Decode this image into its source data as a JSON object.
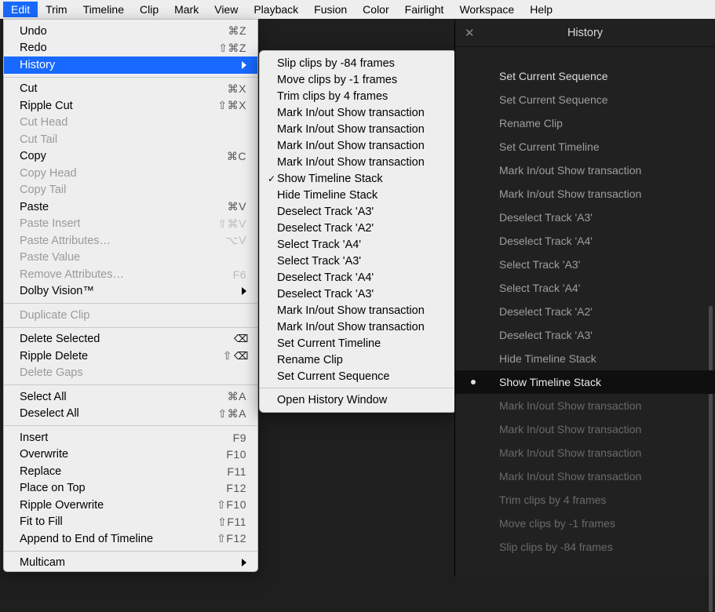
{
  "menubar": {
    "items": [
      "Edit",
      "Trim",
      "Timeline",
      "Clip",
      "Mark",
      "View",
      "Playback",
      "Fusion",
      "Color",
      "Fairlight",
      "Workspace",
      "Help"
    ],
    "active_index": 0
  },
  "edit_menu": {
    "groups": [
      [
        {
          "label": "Undo",
          "shortcut": "⌘Z",
          "disabled": false
        },
        {
          "label": "Redo",
          "shortcut": "⇧⌘Z",
          "disabled": false
        },
        {
          "label": "History",
          "submenu": true,
          "highlight": true
        }
      ],
      [
        {
          "label": "Cut",
          "shortcut": "⌘X",
          "disabled": false
        },
        {
          "label": "Ripple Cut",
          "shortcut": "⇧⌘X",
          "disabled": false
        },
        {
          "label": "Cut Head",
          "disabled": true
        },
        {
          "label": "Cut Tail",
          "disabled": true
        },
        {
          "label": "Copy",
          "shortcut": "⌘C",
          "disabled": false
        },
        {
          "label": "Copy Head",
          "disabled": true
        },
        {
          "label": "Copy Tail",
          "disabled": true
        },
        {
          "label": "Paste",
          "shortcut": "⌘V",
          "disabled": false
        },
        {
          "label": "Paste Insert",
          "shortcut": "⇧⌘V",
          "disabled": true
        },
        {
          "label": "Paste Attributes…",
          "shortcut": "⌥V",
          "disabled": true
        },
        {
          "label": "Paste Value",
          "disabled": true
        },
        {
          "label": "Remove Attributes…",
          "shortcut": "F6",
          "disabled": true
        },
        {
          "label": "Dolby Vision™",
          "submenu": true,
          "disabled": false
        }
      ],
      [
        {
          "label": "Duplicate Clip",
          "disabled": true
        }
      ],
      [
        {
          "label": "Delete Selected",
          "glyph": "⌫",
          "disabled": false
        },
        {
          "label": "Ripple Delete",
          "shortcut": "⇧",
          "glyph": "⌫",
          "disabled": false
        },
        {
          "label": "Delete Gaps",
          "disabled": true
        }
      ],
      [
        {
          "label": "Select All",
          "shortcut": "⌘A",
          "disabled": false
        },
        {
          "label": "Deselect All",
          "shortcut": "⇧⌘A",
          "disabled": false
        }
      ],
      [
        {
          "label": "Insert",
          "shortcut": "F9",
          "disabled": false
        },
        {
          "label": "Overwrite",
          "shortcut": "F10",
          "disabled": false
        },
        {
          "label": "Replace",
          "shortcut": "F11",
          "disabled": false
        },
        {
          "label": "Place on Top",
          "shortcut": "F12",
          "disabled": false
        },
        {
          "label": "Ripple Overwrite",
          "shortcut": "⇧F10",
          "disabled": false
        },
        {
          "label": "Fit to Fill",
          "shortcut": "⇧F11",
          "disabled": false
        },
        {
          "label": "Append to End of Timeline",
          "shortcut": "⇧F12",
          "disabled": false
        }
      ],
      [
        {
          "label": "Multicam",
          "submenu": true,
          "disabled": false
        }
      ]
    ]
  },
  "history_submenu": {
    "items": [
      {
        "label": "Slip clips by -84 frames"
      },
      {
        "label": "Move clips by -1 frames"
      },
      {
        "label": "Trim clips by 4 frames"
      },
      {
        "label": "Mark In/out Show transaction"
      },
      {
        "label": "Mark In/out Show transaction"
      },
      {
        "label": "Mark In/out Show transaction"
      },
      {
        "label": "Mark In/out Show transaction"
      },
      {
        "label": "Show Timeline Stack",
        "checked": true
      },
      {
        "label": "Hide Timeline Stack"
      },
      {
        "label": "Deselect Track 'A3'"
      },
      {
        "label": "Deselect Track 'A2'"
      },
      {
        "label": "Select Track 'A4'"
      },
      {
        "label": "Select Track 'A3'"
      },
      {
        "label": "Deselect Track 'A4'"
      },
      {
        "label": "Deselect Track 'A3'"
      },
      {
        "label": "Mark In/out Show transaction"
      },
      {
        "label": "Mark In/out Show transaction"
      },
      {
        "label": "Set Current Timeline"
      },
      {
        "label": "Rename Clip"
      },
      {
        "label": "Set Current Sequence"
      }
    ],
    "footer": {
      "label": "Open History Window"
    }
  },
  "history_panel": {
    "title": "History",
    "items": [
      {
        "label": "Set Current Sequence",
        "tone": "bright"
      },
      {
        "label": "Set Current Sequence",
        "tone": "mid"
      },
      {
        "label": "Rename Clip",
        "tone": "mid"
      },
      {
        "label": "Set Current Timeline",
        "tone": "mid"
      },
      {
        "label": "Mark In/out Show transaction",
        "tone": "mid"
      },
      {
        "label": "Mark In/out Show transaction",
        "tone": "mid"
      },
      {
        "label": "Deselect Track 'A3'",
        "tone": "mid"
      },
      {
        "label": "Deselect Track 'A4'",
        "tone": "mid"
      },
      {
        "label": "Select Track 'A3'",
        "tone": "mid"
      },
      {
        "label": "Select Track 'A4'",
        "tone": "mid"
      },
      {
        "label": "Deselect Track 'A2'",
        "tone": "mid"
      },
      {
        "label": "Deselect Track 'A3'",
        "tone": "mid"
      },
      {
        "label": "Hide Timeline Stack",
        "tone": "mid"
      },
      {
        "label": "Show Timeline Stack",
        "tone": "bright",
        "current": true
      },
      {
        "label": "Mark In/out Show transaction",
        "tone": "dim"
      },
      {
        "label": "Mark In/out Show transaction",
        "tone": "dim"
      },
      {
        "label": "Mark In/out Show transaction",
        "tone": "dim"
      },
      {
        "label": "Mark In/out Show transaction",
        "tone": "dim"
      },
      {
        "label": "Trim clips by 4 frames",
        "tone": "dim"
      },
      {
        "label": "Move clips by -1 frames",
        "tone": "dim"
      },
      {
        "label": "Slip clips by -84 frames",
        "tone": "dim"
      }
    ]
  }
}
